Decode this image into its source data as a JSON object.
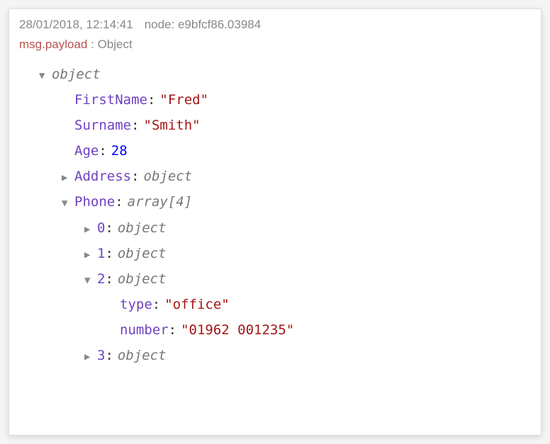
{
  "header": {
    "timestamp": "28/01/2018, 12:14:41",
    "node_label": "node: e9bfcf86.03984"
  },
  "msg_line": {
    "path": "msg.payload",
    "sep": " : ",
    "type": "Object"
  },
  "tree": {
    "root_label": "object",
    "firstname_key": "FirstName",
    "firstname_val": "\"Fred\"",
    "surname_key": "Surname",
    "surname_val": "\"Smith\"",
    "age_key": "Age",
    "age_val": "28",
    "address_key": "Address",
    "address_type": "object",
    "phone_key": "Phone",
    "phone_type": "array[4]",
    "phone_items": {
      "i0_key": "0",
      "i0_type": "object",
      "i1_key": "1",
      "i1_type": "object",
      "i2_key": "2",
      "i2_type": "object",
      "i2_type_key": "type",
      "i2_type_val": "\"office\"",
      "i2_number_key": "number",
      "i2_number_val": "\"01962 001235\"",
      "i3_key": "3",
      "i3_type": "object"
    }
  }
}
